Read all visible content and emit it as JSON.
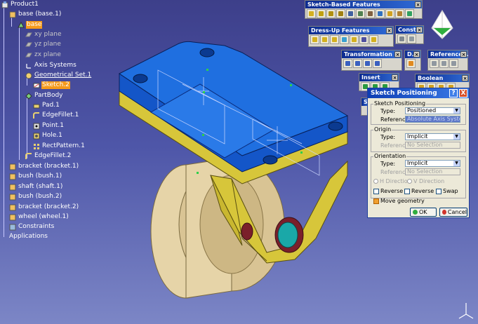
{
  "tree": {
    "items": [
      {
        "label": "Product1"
      },
      {
        "label": "base (base.1)"
      },
      {
        "label": "base"
      },
      {
        "label": "xy plane"
      },
      {
        "label": "yz plane"
      },
      {
        "label": "zx plane"
      },
      {
        "label": "Axis Systems"
      },
      {
        "label": "Geometrical Set.1"
      },
      {
        "label": "Sketch.2"
      },
      {
        "label": "PartBody"
      },
      {
        "label": "Pad.1"
      },
      {
        "label": "EdgeFillet.1"
      },
      {
        "label": "Point.1"
      },
      {
        "label": "Hole.1"
      },
      {
        "label": "RectPattern.1"
      },
      {
        "label": "EdgeFillet.2"
      },
      {
        "label": "bracket (bracket.1)"
      },
      {
        "label": "bush (bush.1)"
      },
      {
        "label": "shaft (shaft.1)"
      },
      {
        "label": "bush (bush.2)"
      },
      {
        "label": "bracket (bracket.2)"
      },
      {
        "label": "wheel (wheel.1)"
      },
      {
        "label": "Constraints"
      },
      {
        "label": "Applications"
      }
    ]
  },
  "toolbars": {
    "sketch_based": "Sketch-Based Features",
    "constraints": "Const...",
    "dress_up": "Dress-Up Features",
    "transformation": "Transformation F...",
    "d": "D...",
    "reference": "Reference...",
    "insert": "Insert",
    "boolean": "Boolean Operations",
    "s": "S"
  },
  "dialog": {
    "title": "Sketch Positioning",
    "help": "?",
    "close": "X",
    "sketch_positioning_group": "Sketch Positioning",
    "type_label": "Type:",
    "type_value": "Positioned",
    "reference_label": "Reference:",
    "reference_value": "Absolute Axis System",
    "origin_group": "Origin",
    "origin_type_label": "Type:",
    "origin_type_value": "Implicit",
    "origin_reference_label": "Reference:",
    "origin_reference_value": "No Selection",
    "orientation_group": "Orientation",
    "orientation_type_label": "Type:",
    "orientation_type_value": "Implicit",
    "orientation_reference_label": "Reference:",
    "orientation_reference_value": "No Selection",
    "h_direction": "H Direction",
    "v_direction": "V Direction",
    "reverse_h": "Reverse H",
    "reverse_v": "Reverse V",
    "swap": "Swap",
    "move_geometry": "Move geometry",
    "ok": "OK",
    "cancel": "Cancel"
  },
  "colors": {
    "highlight": "#f59a1c",
    "part_blue": "#1f6fe0",
    "part_yellow": "#d7c63a",
    "wheel_tan": "#e6d4a8"
  }
}
